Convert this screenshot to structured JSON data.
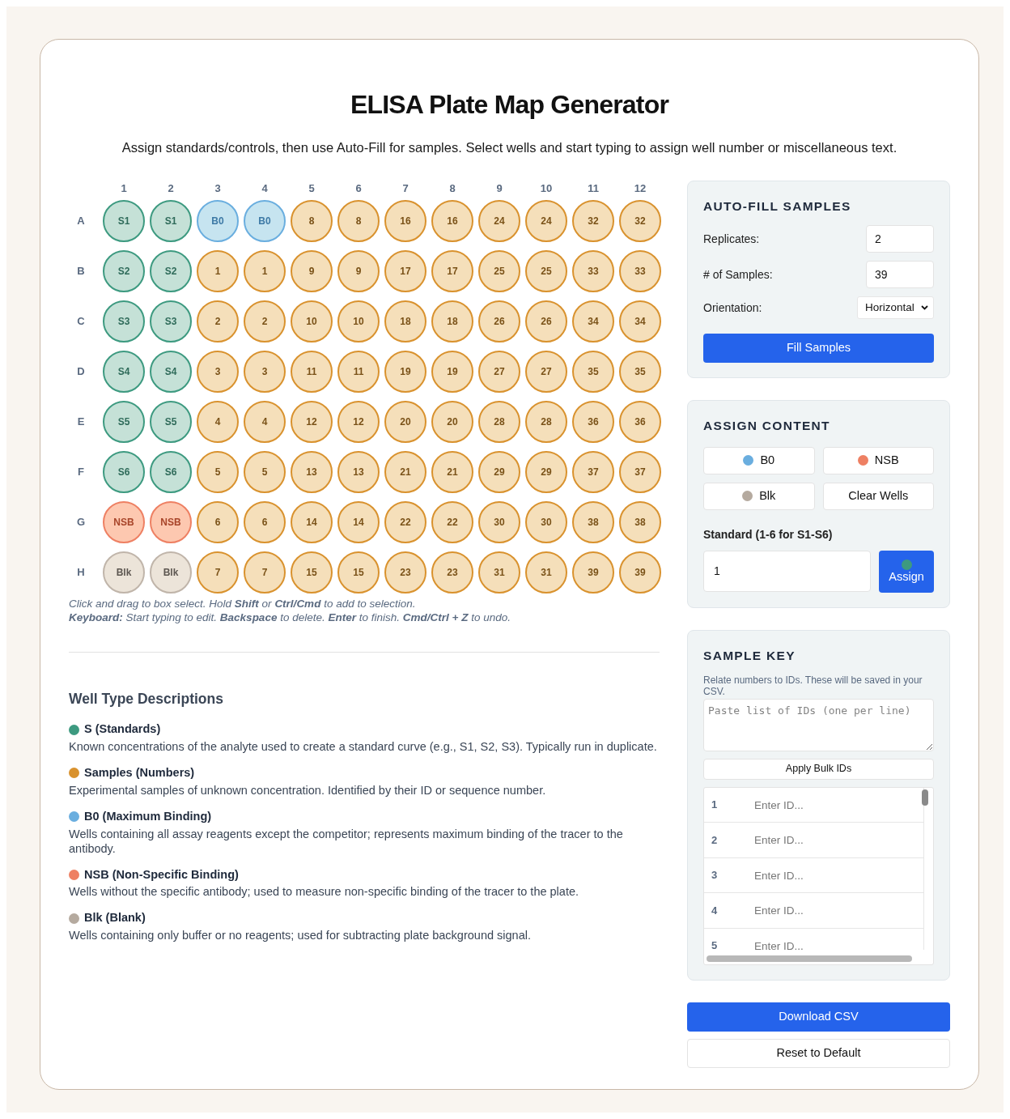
{
  "title": "ELISA Plate Map Generator",
  "subtitle": "Assign standards/controls, then use Auto-Fill for samples. Select wells and start typing to assign well number or miscellaneous text.",
  "plate": {
    "columns": [
      "1",
      "2",
      "3",
      "4",
      "5",
      "6",
      "7",
      "8",
      "9",
      "10",
      "11",
      "12"
    ],
    "rows": [
      {
        "label": "A",
        "wells": [
          {
            "label": "S1",
            "kind": "standard"
          },
          {
            "label": "S1",
            "kind": "standard"
          },
          {
            "label": "B0",
            "kind": "b0"
          },
          {
            "label": "B0",
            "kind": "b0"
          },
          {
            "label": "8",
            "kind": "sample"
          },
          {
            "label": "8",
            "kind": "sample"
          },
          {
            "label": "16",
            "kind": "sample"
          },
          {
            "label": "16",
            "kind": "sample"
          },
          {
            "label": "24",
            "kind": "sample"
          },
          {
            "label": "24",
            "kind": "sample"
          },
          {
            "label": "32",
            "kind": "sample"
          },
          {
            "label": "32",
            "kind": "sample"
          }
        ]
      },
      {
        "label": "B",
        "wells": [
          {
            "label": "S2",
            "kind": "standard"
          },
          {
            "label": "S2",
            "kind": "standard"
          },
          {
            "label": "1",
            "kind": "sample"
          },
          {
            "label": "1",
            "kind": "sample"
          },
          {
            "label": "9",
            "kind": "sample"
          },
          {
            "label": "9",
            "kind": "sample"
          },
          {
            "label": "17",
            "kind": "sample"
          },
          {
            "label": "17",
            "kind": "sample"
          },
          {
            "label": "25",
            "kind": "sample"
          },
          {
            "label": "25",
            "kind": "sample"
          },
          {
            "label": "33",
            "kind": "sample"
          },
          {
            "label": "33",
            "kind": "sample"
          }
        ]
      },
      {
        "label": "C",
        "wells": [
          {
            "label": "S3",
            "kind": "standard"
          },
          {
            "label": "S3",
            "kind": "standard"
          },
          {
            "label": "2",
            "kind": "sample"
          },
          {
            "label": "2",
            "kind": "sample"
          },
          {
            "label": "10",
            "kind": "sample"
          },
          {
            "label": "10",
            "kind": "sample"
          },
          {
            "label": "18",
            "kind": "sample"
          },
          {
            "label": "18",
            "kind": "sample"
          },
          {
            "label": "26",
            "kind": "sample"
          },
          {
            "label": "26",
            "kind": "sample"
          },
          {
            "label": "34",
            "kind": "sample"
          },
          {
            "label": "34",
            "kind": "sample"
          }
        ]
      },
      {
        "label": "D",
        "wells": [
          {
            "label": "S4",
            "kind": "standard"
          },
          {
            "label": "S4",
            "kind": "standard"
          },
          {
            "label": "3",
            "kind": "sample"
          },
          {
            "label": "3",
            "kind": "sample"
          },
          {
            "label": "11",
            "kind": "sample"
          },
          {
            "label": "11",
            "kind": "sample"
          },
          {
            "label": "19",
            "kind": "sample"
          },
          {
            "label": "19",
            "kind": "sample"
          },
          {
            "label": "27",
            "kind": "sample"
          },
          {
            "label": "27",
            "kind": "sample"
          },
          {
            "label": "35",
            "kind": "sample"
          },
          {
            "label": "35",
            "kind": "sample"
          }
        ]
      },
      {
        "label": "E",
        "wells": [
          {
            "label": "S5",
            "kind": "standard"
          },
          {
            "label": "S5",
            "kind": "standard"
          },
          {
            "label": "4",
            "kind": "sample"
          },
          {
            "label": "4",
            "kind": "sample"
          },
          {
            "label": "12",
            "kind": "sample"
          },
          {
            "label": "12",
            "kind": "sample"
          },
          {
            "label": "20",
            "kind": "sample"
          },
          {
            "label": "20",
            "kind": "sample"
          },
          {
            "label": "28",
            "kind": "sample"
          },
          {
            "label": "28",
            "kind": "sample"
          },
          {
            "label": "36",
            "kind": "sample"
          },
          {
            "label": "36",
            "kind": "sample"
          }
        ]
      },
      {
        "label": "F",
        "wells": [
          {
            "label": "S6",
            "kind": "standard"
          },
          {
            "label": "S6",
            "kind": "standard"
          },
          {
            "label": "5",
            "kind": "sample"
          },
          {
            "label": "5",
            "kind": "sample"
          },
          {
            "label": "13",
            "kind": "sample"
          },
          {
            "label": "13",
            "kind": "sample"
          },
          {
            "label": "21",
            "kind": "sample"
          },
          {
            "label": "21",
            "kind": "sample"
          },
          {
            "label": "29",
            "kind": "sample"
          },
          {
            "label": "29",
            "kind": "sample"
          },
          {
            "label": "37",
            "kind": "sample"
          },
          {
            "label": "37",
            "kind": "sample"
          }
        ]
      },
      {
        "label": "G",
        "wells": [
          {
            "label": "NSB",
            "kind": "nsb"
          },
          {
            "label": "NSB",
            "kind": "nsb"
          },
          {
            "label": "6",
            "kind": "sample"
          },
          {
            "label": "6",
            "kind": "sample"
          },
          {
            "label": "14",
            "kind": "sample"
          },
          {
            "label": "14",
            "kind": "sample"
          },
          {
            "label": "22",
            "kind": "sample"
          },
          {
            "label": "22",
            "kind": "sample"
          },
          {
            "label": "30",
            "kind": "sample"
          },
          {
            "label": "30",
            "kind": "sample"
          },
          {
            "label": "38",
            "kind": "sample"
          },
          {
            "label": "38",
            "kind": "sample"
          }
        ]
      },
      {
        "label": "H",
        "wells": [
          {
            "label": "Blk",
            "kind": "blk"
          },
          {
            "label": "Blk",
            "kind": "blk"
          },
          {
            "label": "7",
            "kind": "sample"
          },
          {
            "label": "7",
            "kind": "sample"
          },
          {
            "label": "15",
            "kind": "sample"
          },
          {
            "label": "15",
            "kind": "sample"
          },
          {
            "label": "23",
            "kind": "sample"
          },
          {
            "label": "23",
            "kind": "sample"
          },
          {
            "label": "31",
            "kind": "sample"
          },
          {
            "label": "31",
            "kind": "sample"
          },
          {
            "label": "39",
            "kind": "sample"
          },
          {
            "label": "39",
            "kind": "sample"
          }
        ]
      }
    ]
  },
  "help": [
    "Click and drag to box select. Hold **Shift** or **Ctrl/Cmd** to add to selection.",
    "**Keyboard:** Start typing to edit. **Backspace** to delete. **Enter** to finish. **Cmd/Ctrl + Z** to undo."
  ],
  "descriptions": {
    "heading": "Well Type Descriptions",
    "items": [
      {
        "name": "S (Standards)",
        "color": "#3d9a80",
        "text": "Known concentrations of the analyte used to create a standard curve (e.g., S1, S2, S3). Typically run in duplicate."
      },
      {
        "name": "Samples (Numbers)",
        "color": "#d9922e",
        "text": "Experimental samples of unknown concentration. Identified by their ID or sequence number."
      },
      {
        "name": "B0 (Maximum Binding)",
        "color": "#6aaedf",
        "text": "Wells containing all assay reagents except the competitor; represents maximum binding of the tracer to the antibody."
      },
      {
        "name": "NSB (Non-Specific Binding)",
        "color": "#ee8063",
        "text": "Wells without the specific antibody; used to measure non-specific binding of the tracer to the plate."
      },
      {
        "name": "Blk (Blank)",
        "color": "#b5aa9f",
        "text": "Wells containing only buffer or no reagents; used for subtracting plate background signal."
      }
    ]
  },
  "autofill": {
    "heading": "AUTO-FILL SAMPLES",
    "replicates_label": "Replicates:",
    "replicates": "2",
    "samples_label": "# of Samples:",
    "samples": "39",
    "orientation_label": "Orientation:",
    "orientation": "Horizontal",
    "button": "Fill Samples"
  },
  "assign": {
    "heading": "ASSIGN CONTENT",
    "buttons": [
      {
        "label": "B0",
        "kind": "dot",
        "color": "#6aaedf"
      },
      {
        "label": "NSB",
        "kind": "dot",
        "color": "#ee8063"
      },
      {
        "label": "Blk",
        "kind": "dot",
        "color": "#b5aa9f"
      },
      {
        "label": "Clear Wells",
        "kind": "plain"
      }
    ],
    "standard_label": "Standard (1-6 for S1-S6)",
    "standard_value": "1",
    "assign_button": {
      "label": "Assign",
      "color": "#3d9a80"
    }
  },
  "sample_key": {
    "heading": "SAMPLE KEY",
    "note": "Relate numbers to IDs. These will be saved in your CSV.",
    "bulk_placeholder": "Paste list of IDs (one per line)",
    "apply_button": "Apply Bulk IDs",
    "rows": [
      {
        "number": "1",
        "placeholder": "Enter ID..."
      },
      {
        "number": "2",
        "placeholder": "Enter ID..."
      },
      {
        "number": "3",
        "placeholder": "Enter ID..."
      },
      {
        "number": "4",
        "placeholder": "Enter ID..."
      },
      {
        "number": "5",
        "placeholder": "Enter ID..."
      }
    ]
  },
  "download_button": "Download CSV",
  "reset_button": "Reset to Default"
}
